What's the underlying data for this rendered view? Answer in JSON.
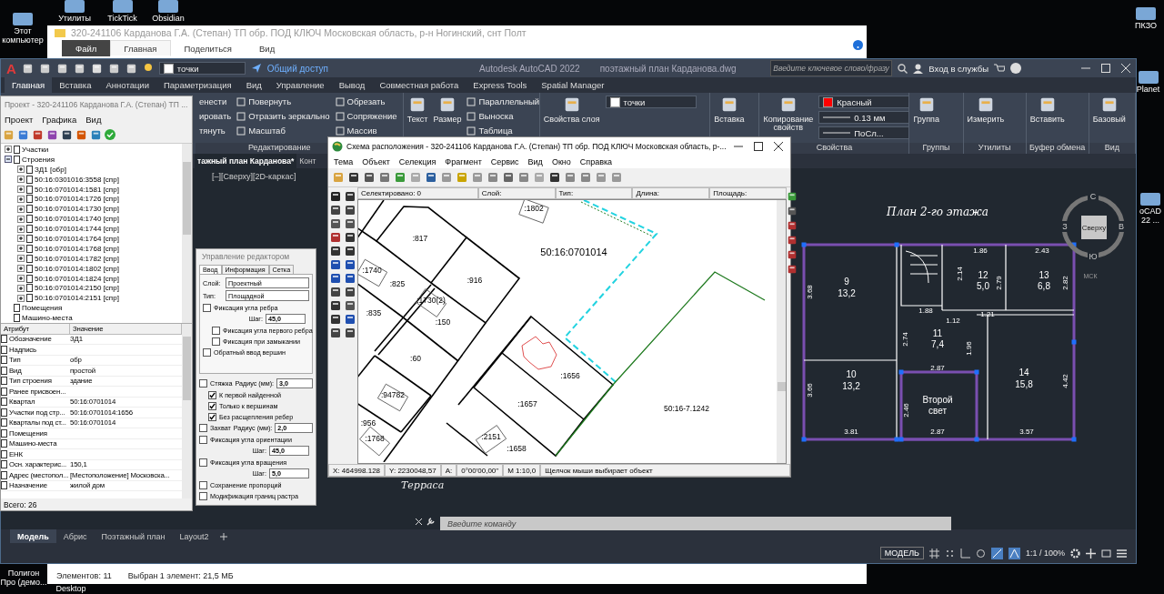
{
  "desktop_icons": [
    {
      "label": "Этот компьютер"
    },
    {
      "label": "Утилиты"
    },
    {
      "label": "TickTick"
    },
    {
      "label": "Obsidian"
    },
    {
      "label": "ПКЗО"
    },
    {
      "label": "Planet"
    },
    {
      "label": "oCAD 22 ..."
    },
    {
      "label": "Полигон Про (демо..."
    },
    {
      "label": "Desktop"
    }
  ],
  "explorer": {
    "title": "320-241106 Карданова Г.А. (Степан) ТП обр. ПОД КЛЮЧ Московская область, р-н Ногинский, снт Полт",
    "tabs": [
      {
        "label": "Файл",
        "kind": "file",
        "selected": false
      },
      {
        "label": "Главная",
        "kind": "tab",
        "selected": true
      },
      {
        "label": "Поделиться",
        "kind": "tab",
        "selected": false
      },
      {
        "label": "Вид",
        "kind": "tab",
        "selected": false
      }
    ],
    "status": [
      "Элементов: 11",
      "Выбран 1 элемент: 21,5 МБ"
    ]
  },
  "autocad": {
    "logo": "A",
    "quick_layer": "точки",
    "share": "Общий доступ",
    "title": "Autodesk AutoCAD 2022",
    "file": "поэтажный план Карданова.dwg",
    "search": {
      "placeholder": "Введите ключевое слово/фразу"
    },
    "signin": "Вход в службы",
    "tabs": [
      {
        "label": "Главная",
        "selected": true
      },
      {
        "label": "Вставка",
        "selected": false
      },
      {
        "label": "Аннотации",
        "selected": false
      },
      {
        "label": "Параметризация",
        "selected": false
      },
      {
        "label": "Вид",
        "selected": false
      },
      {
        "label": "Управление",
        "selected": false
      },
      {
        "label": "Вывод",
        "selected": false
      },
      {
        "label": "Совместная работа",
        "selected": false
      },
      {
        "label": "Express Tools",
        "selected": false
      },
      {
        "label": "Spatial Manager",
        "selected": false
      }
    ],
    "ribbon": [
      {
        "title": "Редактирование",
        "columns": [
          [
            "енести",
            "ировать",
            "тянуть"
          ],
          [
            "Повернуть",
            "Отразить зеркально",
            "Масштаб"
          ],
          [
            "Обрезать",
            "Сопряжение",
            "Массив"
          ]
        ]
      },
      {
        "large": [
          "Текст",
          "Размер"
        ],
        "columns": [
          [
            "Параллельный",
            "Выноска",
            "Таблица"
          ]
        ]
      },
      {
        "large": [
          "Свойства слоя"
        ],
        "combos": [
          {
            "value": "точки",
            "color": "#ffffff"
          }
        ]
      },
      {
        "large": [
          "Вставка"
        ]
      },
      {
        "title": "Свойства",
        "large": [
          "Копирование свойств"
        ],
        "combos": [
          {
            "value": "Красный",
            "color": "#ff0000"
          },
          {
            "value": "0.13 мм"
          },
          {
            "value": "ПоСл..."
          }
        ]
      },
      {
        "title": "Группы",
        "large": [
          "Группа"
        ]
      },
      {
        "title": "Утилиты",
        "large": [
          "Измерить"
        ]
      },
      {
        "title": "Буфер обмена",
        "large": [
          "Вставить"
        ]
      },
      {
        "title": "Вид",
        "large": [
          "Базовый"
        ]
      }
    ],
    "doc_tabs": [
      {
        "label": "тажный план Карданова*",
        "selected": true
      },
      {
        "label": "Конт",
        "selected": false
      }
    ],
    "viewport_label": "[–][Сверху][2D-каркас]",
    "plan_title": "План 2-го этажа",
    "plan_labels": [
      {
        "text": "9",
        "kind": "room"
      },
      {
        "text": "13,2",
        "kind": "area"
      },
      {
        "text": "1.86",
        "kind": "dim"
      },
      {
        "text": "2.43",
        "kind": "dim"
      },
      {
        "text": "12",
        "kind": "room"
      },
      {
        "text": "5,0",
        "kind": "area"
      },
      {
        "text": "13",
        "kind": "room"
      },
      {
        "text": "6,8",
        "kind": "area"
      },
      {
        "text": "3.68",
        "kind": "vdim"
      },
      {
        "text": "2.14",
        "kind": "vdim"
      },
      {
        "text": "2.79",
        "kind": "vdim"
      },
      {
        "text": "2.82",
        "kind": "vdim"
      },
      {
        "text": "1.88",
        "kind": "dim"
      },
      {
        "text": "1.12",
        "kind": "dim"
      },
      {
        "text": "1.21",
        "kind": "dim"
      },
      {
        "text": "11",
        "kind": "room"
      },
      {
        "text": "7,4",
        "kind": "area"
      },
      {
        "text": "2.74",
        "kind": "vdim"
      },
      {
        "text": "1.96",
        "kind": "vdim"
      },
      {
        "text": "2.87",
        "kind": "dim"
      },
      {
        "text": "10",
        "kind": "room"
      },
      {
        "text": "13,2",
        "kind": "area"
      },
      {
        "text": "14",
        "kind": "room"
      },
      {
        "text": "15,8",
        "kind": "area"
      },
      {
        "text": "3.66",
        "kind": "vdim"
      },
      {
        "text": "4.42",
        "kind": "vdim"
      },
      {
        "text": "2.46",
        "kind": "vdim"
      },
      {
        "text": "Второй свет",
        "kind": "note"
      },
      {
        "text": "3.81",
        "kind": "dim"
      },
      {
        "text": "2.87",
        "kind": "dim"
      },
      {
        "text": "3.57",
        "kind": "dim"
      }
    ],
    "viewcube": {
      "north": "С",
      "south": "Ю",
      "west": "З",
      "east": "В",
      "face": "Сверху",
      "ucs": "МСК"
    },
    "terrace": "Терраса",
    "command": {
      "placeholder": "Введите команду"
    },
    "layouts": [
      {
        "label": "Модель",
        "selected": true
      },
      {
        "label": "Абрис",
        "selected": false
      },
      {
        "label": "Поэтажный план",
        "selected": false
      },
      {
        "label": "Layout2",
        "selected": false
      }
    ],
    "status": [
      "МОДЕЛЬ",
      "1:1 / 100%"
    ]
  },
  "project": {
    "title": "Проект - 320-241106 Карданова Г.А. (Степан) ТП ...",
    "menu": [
      "Проект",
      "Графика",
      "Вид"
    ],
    "tree": [
      {
        "label": "Участки",
        "expanded": false
      },
      {
        "label": "Строения",
        "expanded": true,
        "children": [
          {
            "label": "ЗД1 [обр]",
            "expanded": false
          },
          {
            "label": "50:16:0301016:3558 [спр]",
            "expanded": false
          },
          {
            "label": "50:16:0701014:1581 [спр]",
            "expanded": false
          },
          {
            "label": "50:16:0701014:1726 [спр]",
            "expanded": false
          },
          {
            "label": "50:16:0701014:1730 [спр]",
            "expanded": false
          },
          {
            "label": "50:16:0701014:1740 [спр]",
            "expanded": false
          },
          {
            "label": "50:16:0701014:1744 [спр]",
            "expanded": false
          },
          {
            "label": "50:16:0701014:1764 [спр]",
            "expanded": false
          },
          {
            "label": "50:16:0701014:1768 [спр]",
            "expanded": false
          },
          {
            "label": "50:16:0701014:1782 [спр]",
            "expanded": false
          },
          {
            "label": "50:16:0701014:1802 [спр]",
            "expanded": false
          },
          {
            "label": "50:16:0701014:1824 [спр]",
            "expanded": false
          },
          {
            "label": "50:16:0701014:2150 [спр]",
            "expanded": false
          },
          {
            "label": "50:16:0701014:2151 [спр]",
            "expanded": false
          }
        ]
      },
      {
        "label": "Помещения"
      },
      {
        "label": "Машино-места"
      }
    ],
    "columns": [
      "Атрибут",
      "Значение"
    ],
    "rows": [
      [
        "Обозначение",
        "ЗД1"
      ],
      [
        "Надпись",
        ""
      ],
      [
        "Тип",
        "обр"
      ],
      [
        "Вид",
        "простой"
      ],
      [
        "Тип строения",
        "здание"
      ],
      [
        "Ранее присвоен...",
        ""
      ],
      [
        "Квартал",
        "50:16:0701014"
      ],
      [
        "Участки под стр...",
        "50:16:0701014:1656"
      ],
      [
        "Кварталы под ст...",
        "50:16:0701014"
      ],
      [
        "Помещения",
        ""
      ],
      [
        "Машино-места",
        ""
      ],
      [
        "ЕНК",
        ""
      ],
      [
        "Осн. характерис...",
        "150,1"
      ],
      [
        "Адрес (местопол...",
        "[Местоположение] Московска..."
      ],
      [
        "Назначение",
        "жилой дом"
      ]
    ],
    "footer": "Всего: 26"
  },
  "editor": {
    "title": "Управление редактором",
    "tabs": [
      {
        "label": "Ввод",
        "selected": true
      },
      {
        "label": "Информация",
        "selected": false
      },
      {
        "label": "Сетка",
        "selected": false
      }
    ],
    "fields": [
      {
        "label": "Слой:",
        "value": "Проектный"
      },
      {
        "label": "Тип:",
        "value": "Площадной"
      }
    ],
    "options": [
      {
        "label": "Фиксация угла ребра",
        "checked": false,
        "field": {
          "label": "Шаг:",
          "value": "45,0"
        },
        "children": [
          {
            "label": "Фиксация угла первого ребра",
            "checked": false
          },
          {
            "label": "Фиксация при замыкании",
            "checked": false
          }
        ]
      },
      {
        "label": "Обратный ввод вершин",
        "checked": false
      }
    ],
    "snap_options": [
      {
        "label": "Стяжка",
        "checked": false,
        "inline": {
          "label": "Радиус (мм):",
          "value": "3,0"
        },
        "children": [
          {
            "label": "К первой найденной",
            "checked": true
          },
          {
            "label": "Только к вершинам",
            "checked": true
          },
          {
            "label": "Без расщепления ребер",
            "checked": true
          }
        ]
      },
      {
        "label": "Захват",
        "checked": false,
        "inline": {
          "label": "Радиус (мм):",
          "value": "2,0"
        }
      },
      {
        "label": "Фиксация угла ориентации",
        "checked": false,
        "field": {
          "label": "Шаг:",
          "value": "45,0"
        }
      },
      {
        "label": "Фиксация угла вращения",
        "checked": false,
        "field": {
          "label": "Шаг:",
          "value": "5,0"
        }
      },
      {
        "label": "Сохранение пропорций",
        "checked": false
      },
      {
        "label": "Модификация границ растра",
        "checked": false
      }
    ]
  },
  "map_window": {
    "title": "Схема расположения - 320-241106 Карданова Г.А. (Степан) ТП обр. ПОД КЛЮЧ Московская область, р-...",
    "menu": [
      "Тема",
      "Объект",
      "Селекция",
      "Фрагмент",
      "Сервис",
      "Вид",
      "Окно",
      "Справка"
    ],
    "info": [
      "Селектировано: 0",
      "Слой:",
      "Тип:",
      "Длина:",
      "Площадь:"
    ],
    "labels": [
      ":1802",
      ":817",
      "50:16:0701014",
      ":1740",
      ":825",
      ":916",
      ":1730(2)",
      ":835",
      ":150",
      ":60",
      ":1656",
      ":94782",
      ":1657",
      "50:16-7.1242",
      ":956",
      ":1768",
      ":2151",
      ":1658"
    ],
    "status": [
      "X: 464998.128",
      "Y: 2230048,57",
      "A:",
      "0°00'00,00\"",
      "M 1:10,0",
      "Щелчок мыши выбирает объект"
    ]
  }
}
